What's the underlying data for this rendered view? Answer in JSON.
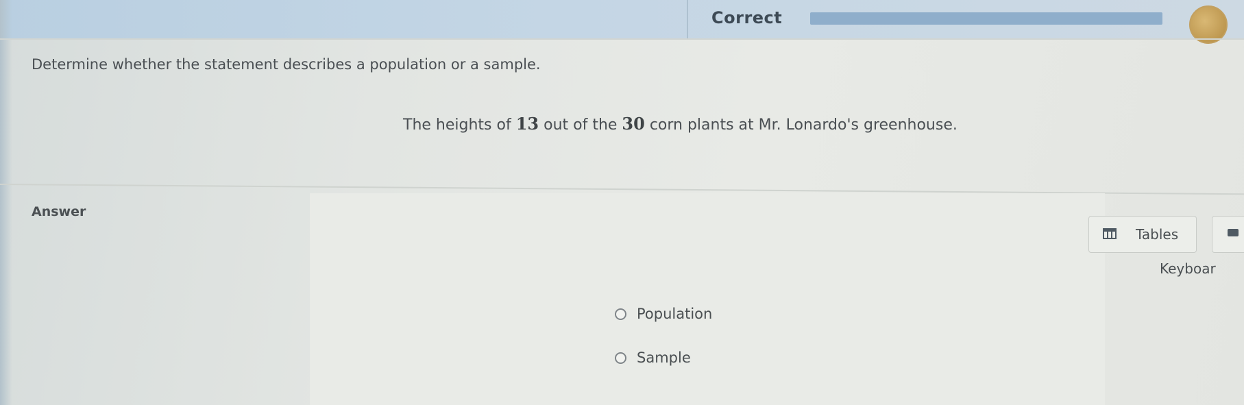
{
  "header": {
    "status": "Correct",
    "progress_fraction": 1.0
  },
  "question": {
    "instruction": "Determine whether the statement describes a population or a sample.",
    "statement_before": "The heights of ",
    "count_part": "13",
    "statement_middle": " out of the ",
    "count_total": "30",
    "statement_after": " corn plants at Mr. Lonardo's greenhouse."
  },
  "answer": {
    "label": "Answer",
    "options": [
      {
        "label": "Population"
      },
      {
        "label": "Sample"
      }
    ]
  },
  "tools": {
    "tables_label": "Tables",
    "keyboard_label": "Keyboar"
  },
  "icons": {
    "tables": "table-icon",
    "keyboard": "keyboard-icon",
    "avatar": "avatar"
  },
  "colors": {
    "header_bg": "#c4d6e5",
    "progress_fill": "#8faecb",
    "text": "#4a4f52"
  }
}
